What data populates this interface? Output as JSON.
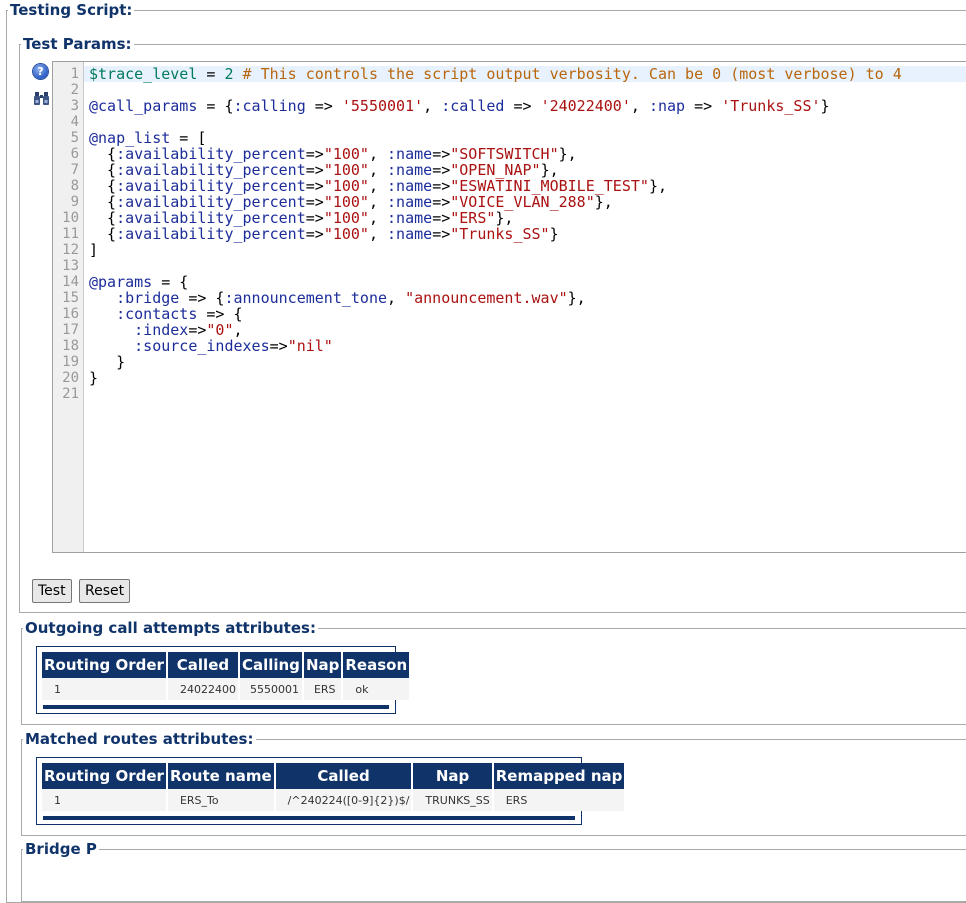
{
  "sections": {
    "testing_script": "Testing Script:",
    "test_params": "Test Params:",
    "outgoing": "Outgoing call attempts attributes:",
    "matched": "Matched routes attributes:",
    "bridge": "Bridge P"
  },
  "icons": {
    "help": "help-icon",
    "find": "binoculars-icon",
    "help_glyph": "?"
  },
  "editor": {
    "line_numbers": [
      "1",
      "2",
      "3",
      "4",
      "5",
      "6",
      "7",
      "8",
      "9",
      "10",
      "11",
      "12",
      "13",
      "14",
      "15",
      "16",
      "17",
      "18",
      "19",
      "20",
      "21"
    ],
    "line1": {
      "a": "$trace_level",
      "b": " = ",
      "c": "2",
      "d": " # This controls the script output verbosity. Can be 0 (most verbose) to 4"
    },
    "line3": {
      "a": "@call_params",
      "b": " = {",
      "c": ":calling",
      "d": " => ",
      "e": "'5550001'",
      "f": ", ",
      "g": ":called",
      "h": " => ",
      "i": "'24022400'",
      "j": ", ",
      "k": ":nap",
      "l": " => ",
      "m": "'Trunks_SS'",
      "n": "}"
    },
    "line5": {
      "a": "@nap_list",
      "b": " = ["
    },
    "naps": [
      {
        "pre": "  {",
        "key": ":availability_percent",
        "arrow": "=>",
        "val": "\"100\"",
        "sep": ", ",
        "key2": ":name",
        "arrow2": "=>",
        "val2": "\"SOFTSWITCH\"",
        "end": "},"
      },
      {
        "pre": "  {",
        "key": ":availability_percent",
        "arrow": "=>",
        "val": "\"100\"",
        "sep": ", ",
        "key2": ":name",
        "arrow2": "=>",
        "val2": "\"OPEN_NAP\"",
        "end": "},"
      },
      {
        "pre": "  {",
        "key": ":availability_percent",
        "arrow": "=>",
        "val": "\"100\"",
        "sep": ", ",
        "key2": ":name",
        "arrow2": "=>",
        "val2": "\"ESWATINI_MOBILE_TEST\"",
        "end": "},"
      },
      {
        "pre": "  {",
        "key": ":availability_percent",
        "arrow": "=>",
        "val": "\"100\"",
        "sep": ", ",
        "key2": ":name",
        "arrow2": "=>",
        "val2": "\"VOICE_VLAN_288\"",
        "end": "},"
      },
      {
        "pre": "  {",
        "key": ":availability_percent",
        "arrow": "=>",
        "val": "\"100\"",
        "sep": ", ",
        "key2": ":name",
        "arrow2": "=>",
        "val2": "\"ERS\"",
        "end": "},"
      },
      {
        "pre": "  {",
        "key": ":availability_percent",
        "arrow": "=>",
        "val": "\"100\"",
        "sep": ", ",
        "key2": ":name",
        "arrow2": "=>",
        "val2": "\"Trunks_SS\"",
        "end": "}"
      }
    ],
    "line12": "]",
    "line14": {
      "a": "@params",
      "b": " = {"
    },
    "line15": {
      "a": "   ",
      "b": ":bridge",
      "c": " => {",
      "d": ":announcement_tone",
      "e": ", ",
      "f": "\"announcement.wav\"",
      "g": "},"
    },
    "line16": {
      "a": "   ",
      "b": ":contacts",
      "c": " => {"
    },
    "line17": {
      "a": "     ",
      "b": ":index",
      "c": "=>",
      "d": "\"0\"",
      "e": ","
    },
    "line18": {
      "a": "     ",
      "b": ":source_indexes",
      "c": "=>",
      "d": "\"nil\""
    },
    "line19": "   }",
    "line20": "}"
  },
  "buttons": {
    "test": "Test",
    "reset": "Reset"
  },
  "outgoing_table": {
    "headers": [
      "Routing Order",
      "Called",
      "Calling",
      "Nap",
      "Reason"
    ],
    "rows": [
      [
        "1",
        "24022400",
        "5550001",
        "ERS",
        "ok"
      ]
    ]
  },
  "matched_table": {
    "headers": [
      "Routing Order",
      "Route name",
      "Called",
      "Nap",
      "Remapped nap"
    ],
    "rows": [
      [
        "1",
        "ERS_To",
        "/^240224([0-9]{2})$/",
        "TRUNKS_SS",
        "ERS"
      ]
    ]
  }
}
